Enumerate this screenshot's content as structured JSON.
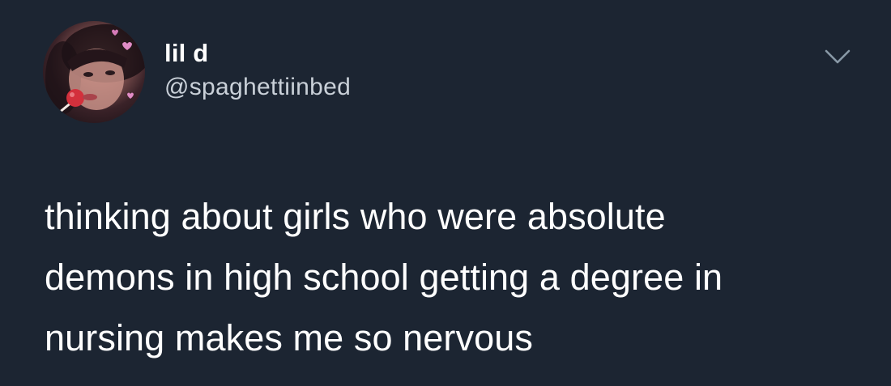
{
  "user": {
    "display_name": "lil d",
    "handle": "@spaghettiinbed"
  },
  "icons": {
    "avatar": "profile-photo",
    "menu": "chevron-down-icon"
  },
  "tweet": {
    "lines": [
      "thinking about girls who were absolute",
      "demons in high school getting a degree in",
      "nursing makes me so nervous"
    ]
  },
  "colors": {
    "background": "#1c2532",
    "text": "#ffffff",
    "secondary_text": "#c9d0d8",
    "icon": "#8899a6"
  }
}
